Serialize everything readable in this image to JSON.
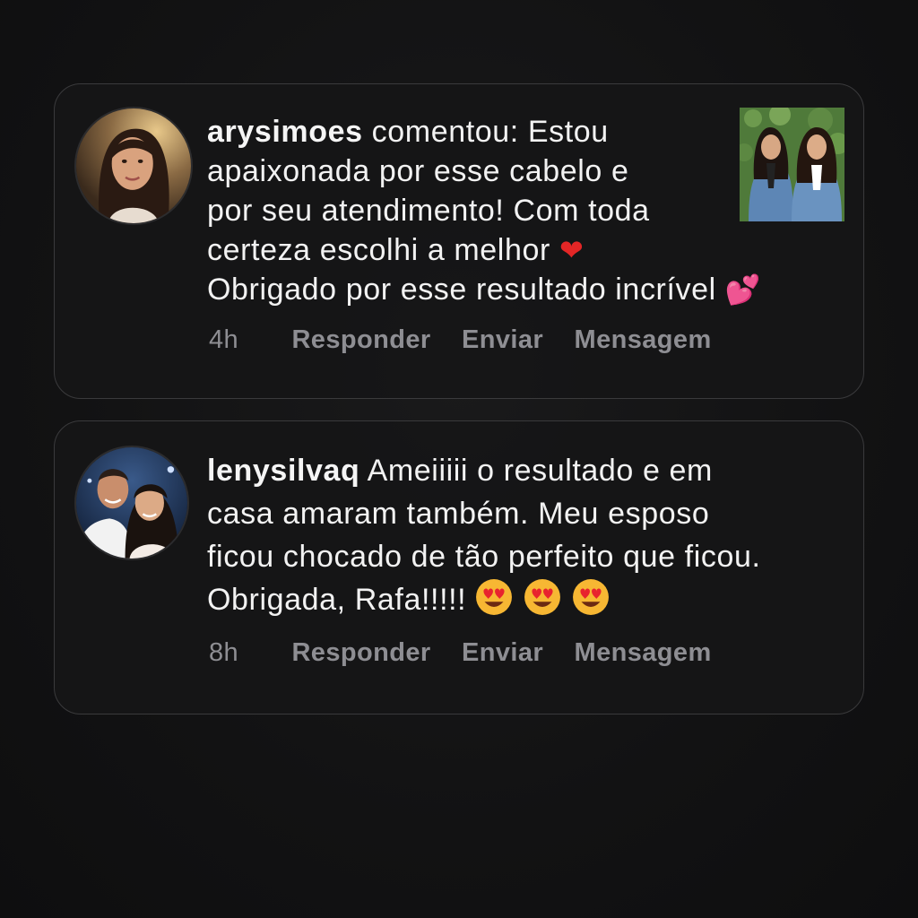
{
  "comments": [
    {
      "username": "arysimoes",
      "lines": [
        " comentou: Estou",
        "apaixonada por esse cabelo e",
        "por seu atendimento! Com toda",
        "certeza escolhi a melhor ",
        "Obrigado por esse resultado incrível "
      ],
      "emojis": [
        "❤",
        "💕"
      ],
      "time": "4h",
      "actions": {
        "reply": "Responder",
        "send": "Enviar",
        "message": "Mensagem"
      },
      "has_thumbnail": true
    },
    {
      "username": "lenysilvaq",
      "lines": [
        " Ameiiiii o resultado e em",
        "casa amaram também. Meu esposo",
        "ficou chocado de tão perfeito que ficou.",
        "Obrigada, Rafa!!!!! "
      ],
      "emojis": [
        "😍",
        "😍",
        "😍"
      ],
      "time": "8h",
      "actions": {
        "reply": "Responder",
        "send": "Enviar",
        "message": "Mensagem"
      },
      "has_thumbnail": false
    }
  ],
  "colors": {
    "background": "#121213",
    "card_border": "#3a3a3c",
    "text": "#f2f2f2",
    "action_text": "#8e8e93"
  }
}
